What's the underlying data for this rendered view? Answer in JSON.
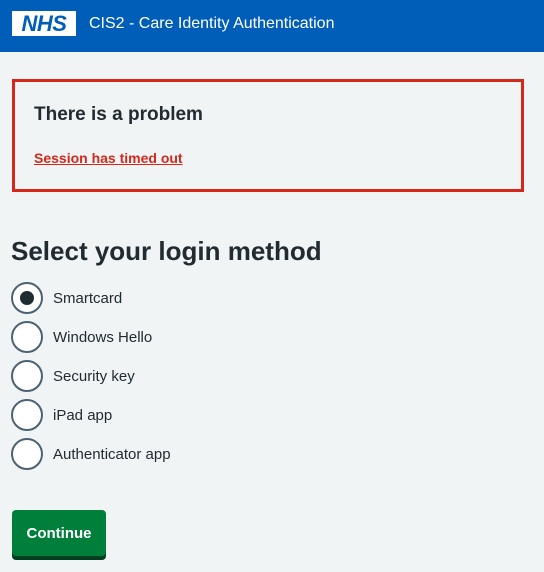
{
  "header": {
    "logo_text": "NHS",
    "service_name": "CIS2 - Care Identity Authentication",
    "colors": {
      "header_bg": "#005eb8",
      "logo_text": "#005eb8"
    }
  },
  "error_summary": {
    "title": "There is a problem",
    "link_text": "Session has timed out",
    "border_color": "#d5281b"
  },
  "main": {
    "heading": "Select your login method",
    "options": [
      {
        "label": "Smartcard",
        "checked": true
      },
      {
        "label": "Windows Hello",
        "checked": false
      },
      {
        "label": "Security key",
        "checked": false
      },
      {
        "label": "iPad app",
        "checked": false
      },
      {
        "label": "Authenticator app",
        "checked": false
      }
    ],
    "continue_label": "Continue",
    "continue_color": "#007f3b"
  }
}
